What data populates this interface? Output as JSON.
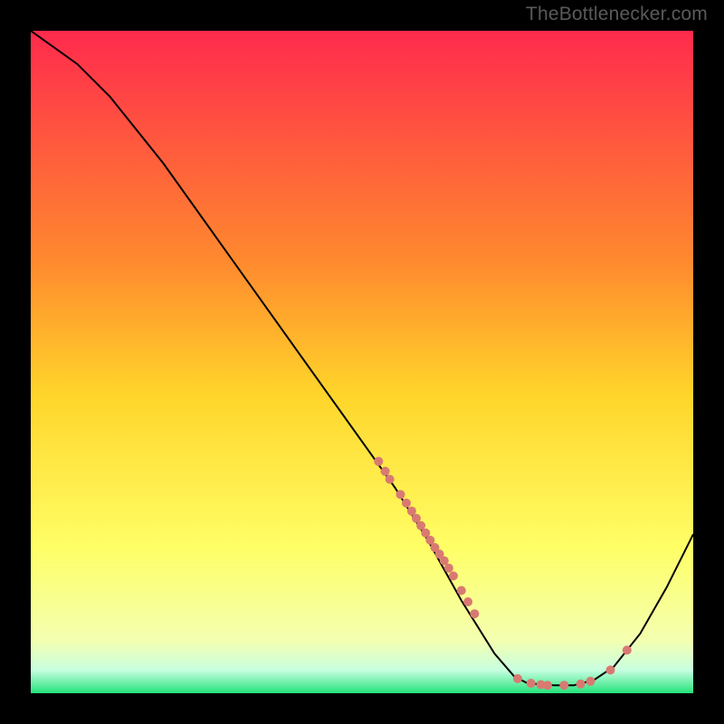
{
  "watermark": "TheBottlenecker.com",
  "chart_data": {
    "type": "line",
    "title": "",
    "xlabel": "",
    "ylabel": "",
    "xlim": [
      0,
      100
    ],
    "ylim": [
      0,
      100
    ],
    "background_gradient": {
      "stops": [
        {
          "at": 0.0,
          "color": "#ff2a4d"
        },
        {
          "at": 0.35,
          "color": "#ff8a2e"
        },
        {
          "at": 0.55,
          "color": "#ffd52a"
        },
        {
          "at": 0.78,
          "color": "#ffff66"
        },
        {
          "at": 0.92,
          "color": "#f4ffb0"
        },
        {
          "at": 0.965,
          "color": "#c8ffe0"
        },
        {
          "at": 1.0,
          "color": "#23e27a"
        }
      ]
    },
    "series": [
      {
        "name": "curve",
        "type": "line",
        "color": "#000000",
        "width": 2,
        "points": [
          {
            "x": 0,
            "y": 100
          },
          {
            "x": 7,
            "y": 95
          },
          {
            "x": 12,
            "y": 90
          },
          {
            "x": 20,
            "y": 80
          },
          {
            "x": 30,
            "y": 66
          },
          {
            "x": 40,
            "y": 52
          },
          {
            "x": 50,
            "y": 38
          },
          {
            "x": 55,
            "y": 31
          },
          {
            "x": 60,
            "y": 23
          },
          {
            "x": 65,
            "y": 14
          },
          {
            "x": 70,
            "y": 6
          },
          {
            "x": 73,
            "y": 2.5
          },
          {
            "x": 75,
            "y": 1.5
          },
          {
            "x": 79,
            "y": 1.2
          },
          {
            "x": 82,
            "y": 1.2
          },
          {
            "x": 85,
            "y": 2
          },
          {
            "x": 88,
            "y": 4
          },
          {
            "x": 92,
            "y": 9
          },
          {
            "x": 96,
            "y": 16
          },
          {
            "x": 100,
            "y": 24
          }
        ]
      },
      {
        "name": "dots",
        "type": "scatter",
        "color": "#d97a72",
        "radius": 5,
        "points": [
          {
            "x": 52.5,
            "y": 35
          },
          {
            "x": 53.5,
            "y": 33.5
          },
          {
            "x": 54.2,
            "y": 32.3
          },
          {
            "x": 55.8,
            "y": 30
          },
          {
            "x": 56.7,
            "y": 28.7
          },
          {
            "x": 57.5,
            "y": 27.5
          },
          {
            "x": 58.2,
            "y": 26.4
          },
          {
            "x": 58.9,
            "y": 25.3
          },
          {
            "x": 59.6,
            "y": 24.2
          },
          {
            "x": 60.3,
            "y": 23.1
          },
          {
            "x": 61.0,
            "y": 22.0
          },
          {
            "x": 61.7,
            "y": 21.0
          },
          {
            "x": 62.4,
            "y": 20.0
          },
          {
            "x": 63.1,
            "y": 18.9
          },
          {
            "x": 63.8,
            "y": 17.7
          },
          {
            "x": 65.0,
            "y": 15.5
          },
          {
            "x": 66.0,
            "y": 13.8
          },
          {
            "x": 67.0,
            "y": 12.0
          },
          {
            "x": 73.5,
            "y": 2.2
          },
          {
            "x": 75.5,
            "y": 1.5
          },
          {
            "x": 77.0,
            "y": 1.3
          },
          {
            "x": 78.0,
            "y": 1.2
          },
          {
            "x": 80.5,
            "y": 1.2
          },
          {
            "x": 83.0,
            "y": 1.4
          },
          {
            "x": 84.5,
            "y": 1.8
          },
          {
            "x": 87.5,
            "y": 3.5
          },
          {
            "x": 90.0,
            "y": 6.5
          }
        ]
      }
    ]
  }
}
